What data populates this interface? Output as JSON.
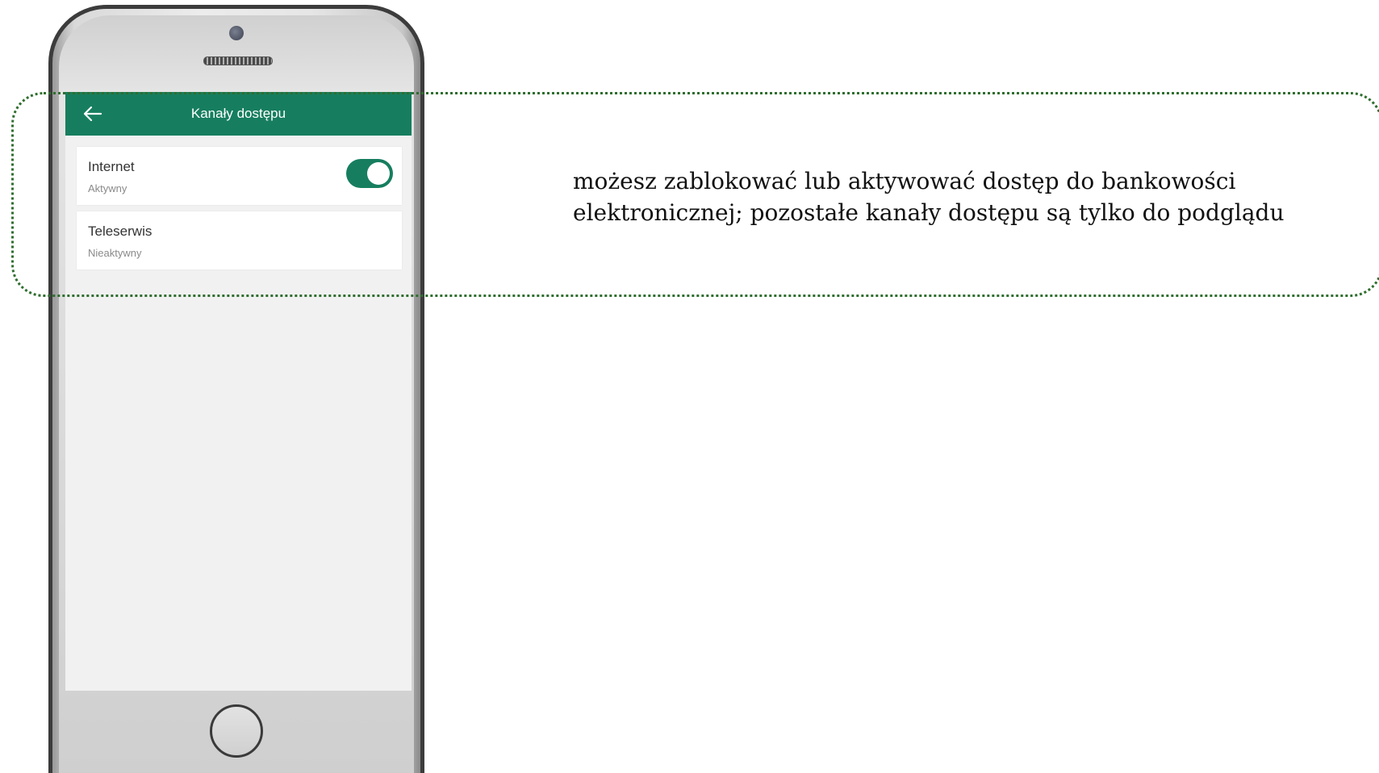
{
  "app_bar": {
    "title": "Kanały dostępu",
    "back_icon": "arrow-left-icon",
    "color": "#167e5f"
  },
  "channels": [
    {
      "name": "Internet",
      "status": "Aktywny",
      "toggle": "on"
    },
    {
      "name": "Teleserwis",
      "status": "Nieaktywny"
    }
  ],
  "annotation": {
    "text": "możesz zablokować lub aktywować dostęp do bankowości elektronicznej; pozostałe kanały dostępu są tylko do podglądu"
  }
}
